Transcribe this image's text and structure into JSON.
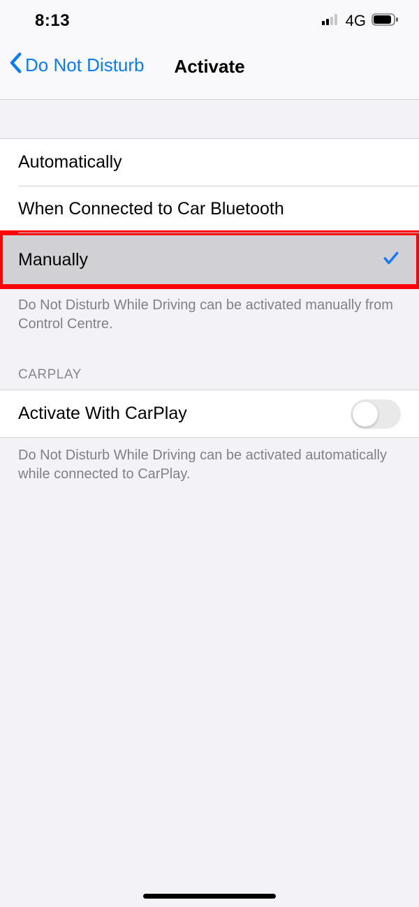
{
  "status": {
    "time": "8:13",
    "network_label": "4G"
  },
  "nav": {
    "back_label": "Do Not Disturb",
    "title": "Activate"
  },
  "options": [
    {
      "label": "Automatically",
      "selected": false
    },
    {
      "label": "When Connected to Car Bluetooth",
      "selected": false
    },
    {
      "label": "Manually",
      "selected": true
    }
  ],
  "options_footer": "Do Not Disturb While Driving can be activated manually from Control Centre.",
  "carplay": {
    "header": "CARPLAY",
    "row_label": "Activate With CarPlay",
    "toggle_on": false,
    "footer": "Do Not Disturb While Driving can be activated automatically while connected to CarPlay."
  },
  "colors": {
    "accent_blue": "#0a7aff",
    "highlight_border": "#ff0000"
  }
}
